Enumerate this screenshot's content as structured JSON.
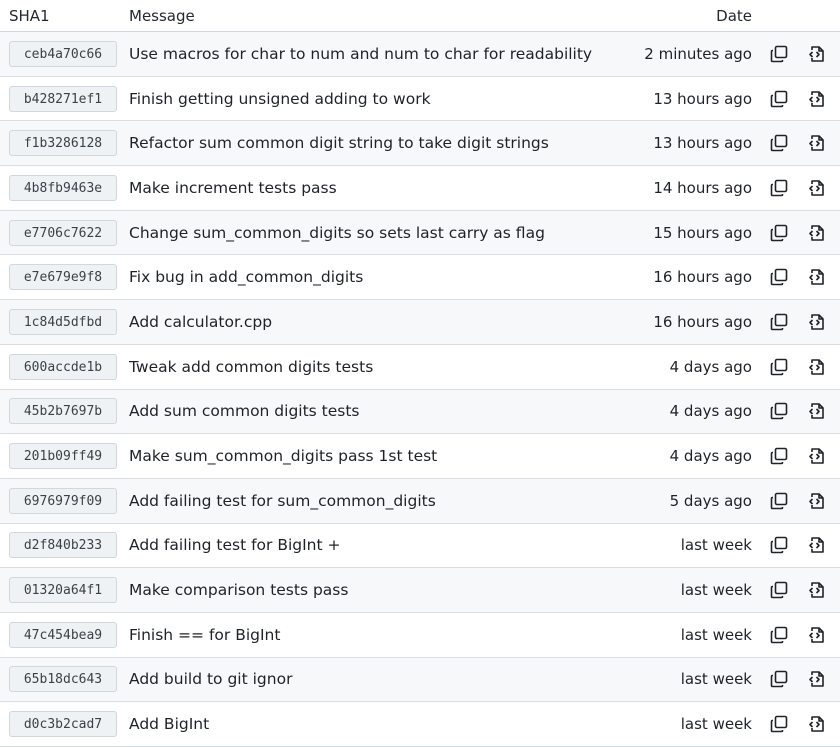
{
  "headers": {
    "sha": "SHA1",
    "message": "Message",
    "date": "Date"
  },
  "icons": {
    "copy": "copy-icon",
    "browse": "browse-files-icon"
  },
  "commits": [
    {
      "sha": "ceb4a70c66",
      "message": "Use macros for char to num and num to char for readability",
      "date": "2 minutes ago"
    },
    {
      "sha": "b428271ef1",
      "message": "Finish getting unsigned adding to work",
      "date": "13 hours ago"
    },
    {
      "sha": "f1b3286128",
      "message": "Refactor sum common digit string to take digit strings",
      "date": "13 hours ago"
    },
    {
      "sha": "4b8fb9463e",
      "message": "Make increment tests pass",
      "date": "14 hours ago"
    },
    {
      "sha": "e7706c7622",
      "message": "Change sum_common_digits so sets last carry as flag",
      "date": "15 hours ago"
    },
    {
      "sha": "e7e679e9f8",
      "message": "Fix bug in add_common_digits",
      "date": "16 hours ago"
    },
    {
      "sha": "1c84d5dfbd",
      "message": "Add calculator.cpp",
      "date": "16 hours ago"
    },
    {
      "sha": "600accde1b",
      "message": "Tweak add common digits tests",
      "date": "4 days ago"
    },
    {
      "sha": "45b2b7697b",
      "message": "Add sum common digits tests",
      "date": "4 days ago"
    },
    {
      "sha": "201b09ff49",
      "message": "Make sum_common_digits pass 1st test",
      "date": "4 days ago"
    },
    {
      "sha": "6976979f09",
      "message": "Add failing test for sum_common_digits",
      "date": "5 days ago"
    },
    {
      "sha": "d2f840b233",
      "message": "Add failing test for BigInt +",
      "date": "last week"
    },
    {
      "sha": "01320a64f1",
      "message": "Make comparison tests pass",
      "date": "last week"
    },
    {
      "sha": "47c454bea9",
      "message": "Finish == for BigInt",
      "date": "last week"
    },
    {
      "sha": "65b18dc643",
      "message": "Add build to git ignor",
      "date": "last week"
    },
    {
      "sha": "d0c3b2cad7",
      "message": "Add BigInt",
      "date": "last week"
    }
  ]
}
